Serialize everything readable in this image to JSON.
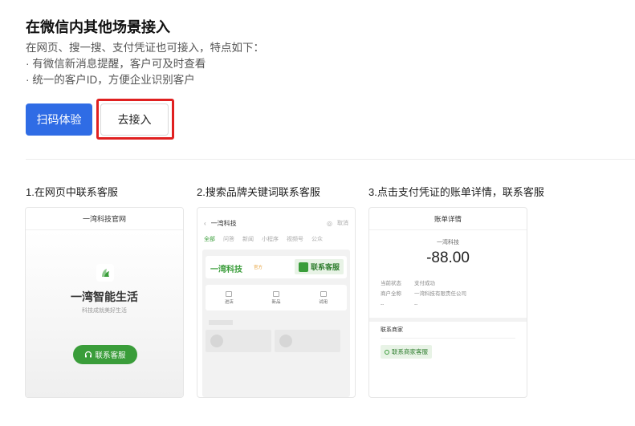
{
  "header": {
    "title": "在微信内其他场景接入",
    "desc_line1": "在网页、搜一搜、支付凭证也可接入，特点如下：",
    "desc_line2": "· 有微信新消息提醒，客户可及时查看",
    "desc_line3": "· 统一的客户ID，方便企业识别客户"
  },
  "actions": {
    "scan_label": "扫码体验",
    "connect_label": "去接入"
  },
  "steps": [
    {
      "label": "1.在网页中联系客服"
    },
    {
      "label": "2.搜索品牌关键词联系客服"
    },
    {
      "label": "3.点击支付凭证的账单详情，联系客服"
    }
  ],
  "card1": {
    "header": "一湾科技官网",
    "brand": "一湾智能生活",
    "slogan": "科技成就美好生活",
    "button": "联系客服"
  },
  "card2": {
    "query": "一湾科技",
    "cancel": "取消",
    "tabs": [
      "全部",
      "问答",
      "新闻",
      "小程序",
      "视频号",
      "公众"
    ],
    "brand": "一湾科技",
    "tag": "官方",
    "cs_button": "联系客服",
    "items": [
      "进店",
      "新品",
      "试用"
    ]
  },
  "card3": {
    "header": "账单详情",
    "merchant": "一湾科技",
    "amount": "-88.00",
    "rows": [
      {
        "k": "当前状态",
        "v": "支付成功"
      },
      {
        "k": "商户全称",
        "v": "一湾科技有限责任公司"
      },
      {
        "k": "--",
        "v": "--"
      }
    ],
    "contact_label": "联系商家",
    "contact_button": "联系商家客服"
  },
  "colors": {
    "primary": "#2f6ce5",
    "highlight": "#e02020",
    "wechat_green": "#3a9d3a"
  }
}
